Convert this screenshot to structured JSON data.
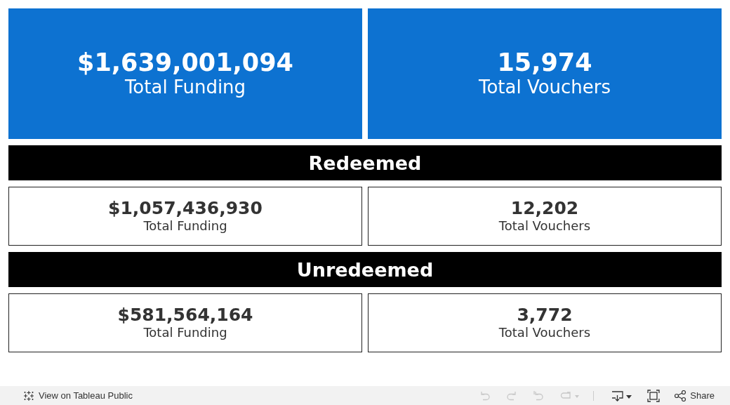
{
  "overview": [
    {
      "value": "$1,639,001,094",
      "label": "Total Funding",
      "kind": "primary"
    },
    {
      "value": "15,974",
      "label": "Total Vouchers",
      "kind": "primary"
    }
  ],
  "sections": [
    {
      "title": "Redeemed",
      "cards": [
        {
          "value": "$1,057,436,930",
          "label": "Total Funding",
          "kind": "outline"
        },
        {
          "value": "12,202",
          "label": "Total Vouchers",
          "kind": "outline"
        }
      ]
    },
    {
      "title": "Unredeemed",
      "cards": [
        {
          "value": "$581,564,164",
          "label": "Total Funding",
          "kind": "outline"
        },
        {
          "value": "3,772",
          "label": "Total Vouchers",
          "kind": "outline"
        }
      ]
    }
  ],
  "toolbar": {
    "link": "View on Tableau Public",
    "tools": [
      {
        "kind": "undo",
        "disabled": true
      },
      {
        "kind": "redo",
        "disabled": true
      },
      {
        "kind": "revert",
        "disabled": true
      },
      {
        "kind": "refresh",
        "disabled": true
      },
      {
        "kind": "download",
        "disabled": false
      },
      {
        "kind": "fullscreen",
        "disabled": false
      }
    ],
    "share": "Share"
  }
}
